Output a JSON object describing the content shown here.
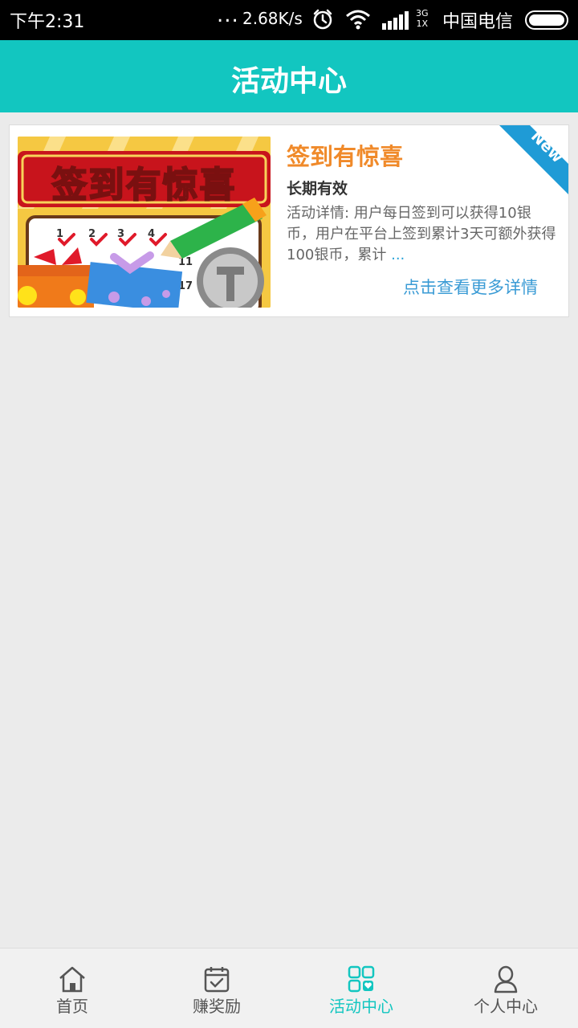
{
  "status_bar": {
    "time": "下午2:31",
    "dots": "...",
    "speed": "2.68K/s",
    "net_top": "3G",
    "net_bottom": "1X",
    "carrier": "中国电信"
  },
  "header": {
    "title": "活动中心"
  },
  "activity": {
    "badge": "New",
    "image_text": "签到有惊喜",
    "title": "签到有惊喜",
    "validity": "长期有效",
    "description": "活动详情: 用户每日签到可以获得10银币，用户在平台上签到累计3天可额外获得100银币，累计",
    "ellipsis": "...",
    "more_link": "点击查看更多详情"
  },
  "tabs": [
    {
      "label": "首页",
      "icon": "home-icon",
      "active": false
    },
    {
      "label": "赚奖励",
      "icon": "calendar-check-icon",
      "active": false
    },
    {
      "label": "活动中心",
      "icon": "grid-heart-icon",
      "active": true
    },
    {
      "label": "个人中心",
      "icon": "person-icon",
      "active": false
    }
  ],
  "colors": {
    "accent": "#12c6c0",
    "title_orange": "#f08a2a",
    "link_blue": "#3a9bd5",
    "ribbon": "#1f9bd6"
  }
}
